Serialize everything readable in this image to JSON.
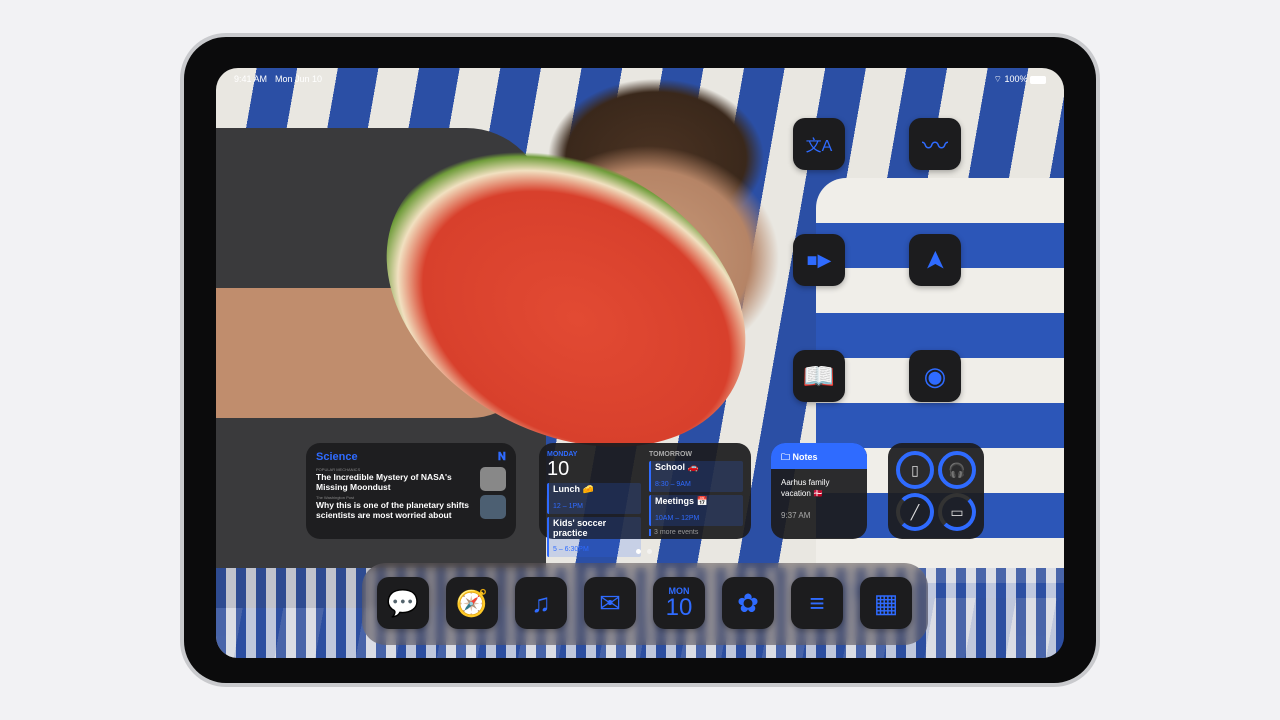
{
  "status_bar": {
    "time": "9:41 AM",
    "date": "Mon Jun 10",
    "battery": "100%"
  },
  "home_apps": [
    {
      "name": "Translate",
      "icon": "translate-icon",
      "glyph": "文A"
    },
    {
      "name": "Freeform",
      "icon": "freeform-icon",
      "glyph": "〰"
    },
    {
      "name": "FaceTime",
      "icon": "video-camera-icon",
      "glyph": "■▶"
    },
    {
      "name": "Maps",
      "icon": "location-arrow-icon",
      "glyph": "➤"
    },
    {
      "name": "Books",
      "icon": "book-icon",
      "glyph": "📖"
    },
    {
      "name": "Podcasts",
      "icon": "podcast-icon",
      "glyph": "◉"
    }
  ],
  "news_widget": {
    "title": "Science",
    "source1": "POPULAR MECHANICS",
    "headline1": "The Incredible Mystery of NASA's Missing Moondust",
    "source2": "The Washington Post",
    "headline2": "Why this is one of the planetary shifts scientists are most worried about"
  },
  "calendar_widget": {
    "day_label": "MONDAY",
    "day_number": "10",
    "tomorrow_label": "TOMORROW",
    "today_events": [
      {
        "title": "Lunch 🧀",
        "time": "12 – 1PM"
      },
      {
        "title": "Kids' soccer practice",
        "time": "5 – 6:30PM"
      }
    ],
    "tomorrow_events": [
      {
        "title": "School 🚗",
        "time": "8:30 – 9AM"
      },
      {
        "title": "Meetings 📅",
        "time": "10AM – 12PM"
      }
    ],
    "more": "3 more events"
  },
  "notes_widget": {
    "title": "Notes",
    "note": "Aarhus family vacation 🇩🇰",
    "time": "9:37 AM"
  },
  "batteries_widget": {
    "devices": [
      {
        "name": "iPad",
        "level": 0.9
      },
      {
        "name": "AirPods",
        "level": 1.0
      },
      {
        "name": "Apple Pencil",
        "level": 0.7
      },
      {
        "name": "AirPods Case",
        "level": 0.6,
        "charging": true
      }
    ]
  },
  "page_dots": {
    "count": 2,
    "current": 1
  },
  "dock": [
    {
      "name": "Messages",
      "glyph": "💬"
    },
    {
      "name": "Safari",
      "glyph": "🧭"
    },
    {
      "name": "Music",
      "glyph": "♫"
    },
    {
      "name": "Mail",
      "glyph": "✉"
    },
    {
      "name": "Calendar",
      "month": "MON",
      "day": "10"
    },
    {
      "name": "Photos",
      "glyph": "✿"
    },
    {
      "name": "Notes",
      "glyph": "≡"
    },
    {
      "name": "App Library",
      "glyph": "▦"
    }
  ],
  "accent": "#2f6bff"
}
